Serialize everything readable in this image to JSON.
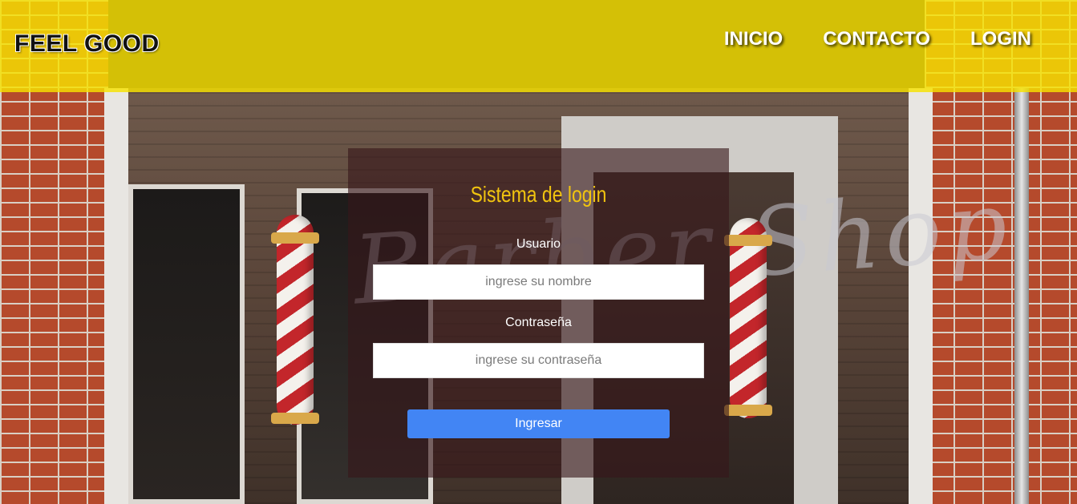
{
  "header": {
    "brand": "FEEL GOOD",
    "nav": [
      {
        "label": "INICIO"
      },
      {
        "label": "CONTACTO"
      },
      {
        "label": "LOGIN"
      }
    ],
    "background_color": "#f7e200"
  },
  "login": {
    "title": "Sistema de login",
    "username_label": "Usuario",
    "username_placeholder": "ingrese su nombre",
    "password_label": "Contraseña",
    "password_placeholder": "ingrese su contraseña",
    "submit_label": "Ingresar",
    "title_color": "#f1c40f",
    "button_color": "#4285f4"
  },
  "background": {
    "store_sign": "Barber Shop"
  }
}
